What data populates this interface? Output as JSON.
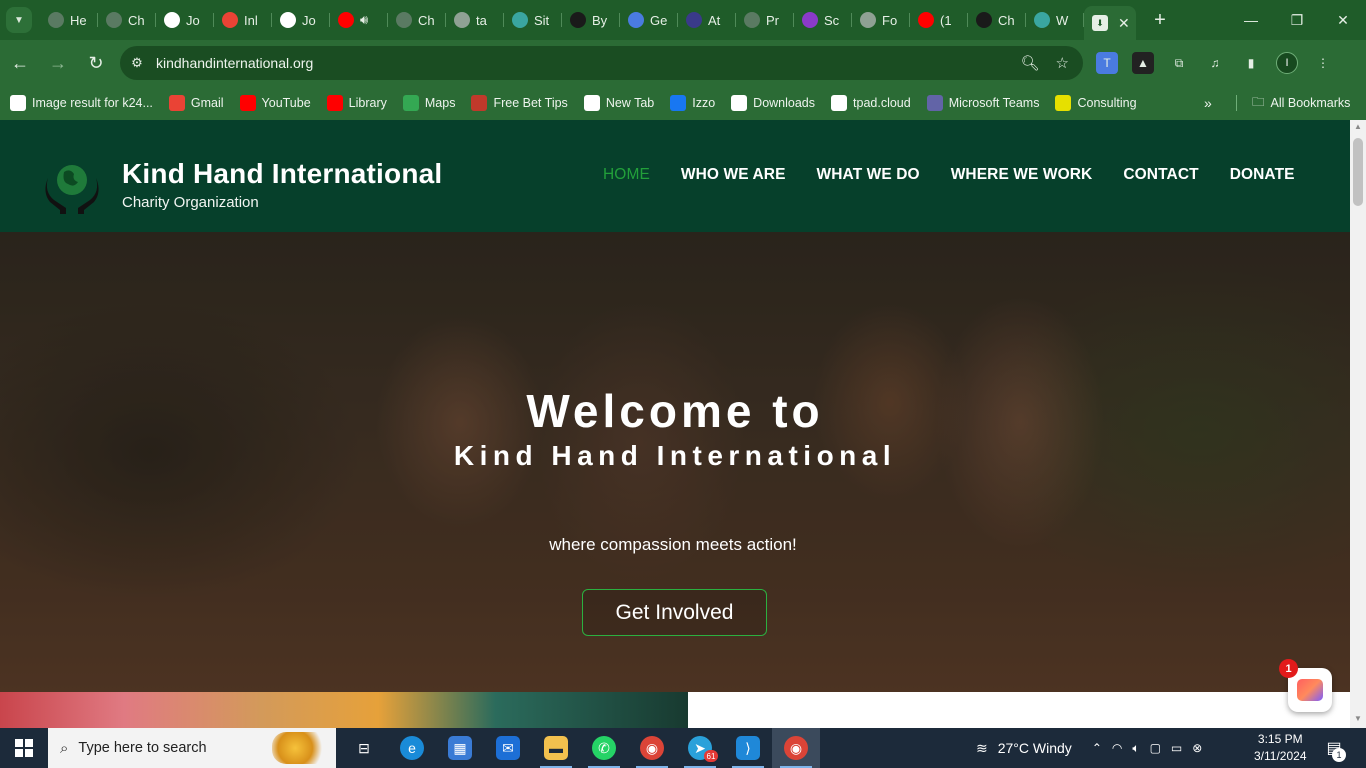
{
  "browser": {
    "tabs": [
      {
        "label": "He",
        "icon": "chatgpt-icon",
        "color": "#5a7a62"
      },
      {
        "label": "Ch",
        "icon": "chatgpt-icon",
        "color": "#5a7a62"
      },
      {
        "label": "Jo",
        "icon": "bookmark-icon",
        "color": "#ffffff"
      },
      {
        "label": "Inl",
        "icon": "gmail-icon",
        "color": "#ea4335"
      },
      {
        "label": "Jo",
        "icon": "bookmark-icon",
        "color": "#ffffff"
      },
      {
        "label": "",
        "icon": "youtube-icon",
        "color": "#ff0000"
      },
      {
        "label": "Ch",
        "icon": "chatgpt-icon",
        "color": "#5a7a62"
      },
      {
        "label": "ta",
        "icon": "globe-icon",
        "color": "#8fa194"
      },
      {
        "label": "Sit",
        "icon": "sitejet-icon",
        "color": "#3aa6a0"
      },
      {
        "label": "By",
        "icon": "openai-icon",
        "color": "#1a1a1a"
      },
      {
        "label": "Ge",
        "icon": "gemini-icon",
        "color": "#4a7be0"
      },
      {
        "label": "At",
        "icon": "atlas-icon",
        "color": "#3a3a8a"
      },
      {
        "label": "Pr",
        "icon": "chatgpt-icon",
        "color": "#5a7a62"
      },
      {
        "label": "Sc",
        "icon": "chart-icon",
        "color": "#8a3ac8"
      },
      {
        "label": "Fo",
        "icon": "globe-icon",
        "color": "#8fa194"
      },
      {
        "label": "(1",
        "icon": "youtube-icon",
        "color": "#ff0000"
      },
      {
        "label": "Ch",
        "icon": "openai-icon",
        "color": "#1a1a1a"
      },
      {
        "label": "W",
        "icon": "sitejet-icon",
        "color": "#3aa6a0"
      }
    ],
    "active_tab_icon": "download-favicon-icon",
    "url": "kindhandinternational.org",
    "bookmarks": [
      {
        "label": "Image result for k24...",
        "icon": "google-icon",
        "color": "#ffffff"
      },
      {
        "label": "Gmail",
        "icon": "gmail-icon",
        "color": "#ea4335"
      },
      {
        "label": "YouTube",
        "icon": "youtube-icon",
        "color": "#ff0000"
      },
      {
        "label": "Library",
        "icon": "youtube-icon",
        "color": "#ff0000"
      },
      {
        "label": "Maps",
        "icon": "maps-icon",
        "color": "#34a853"
      },
      {
        "label": "Free Bet Tips",
        "icon": "bet-icon",
        "color": "#c0392b"
      },
      {
        "label": "New Tab",
        "icon": "globe-icon",
        "color": "#ffffff"
      },
      {
        "label": "Izzo",
        "icon": "facebook-icon",
        "color": "#1877f2"
      },
      {
        "label": "Downloads",
        "icon": "download-icon",
        "color": "#ffffff"
      },
      {
        "label": "tpad.cloud",
        "icon": "globe-icon",
        "color": "#ffffff"
      },
      {
        "label": "Microsoft Teams",
        "icon": "teams-icon",
        "color": "#6264a7"
      },
      {
        "label": "Consulting",
        "icon": "consulting-icon",
        "color": "#e6e000"
      }
    ],
    "all_bookmarks_label": "All Bookmarks",
    "profile_initial": "I"
  },
  "site": {
    "title": "Kind Hand International",
    "subtitle": "Charity Organization",
    "nav": [
      "HOME",
      "WHO WE ARE",
      "WHAT WE DO",
      "WHERE WE WORK",
      "CONTACT",
      "DONATE"
    ],
    "active_nav_color": "#22a03a",
    "header_bg": "#06402b"
  },
  "hero": {
    "heading": "Welcome to",
    "subheading": "Kind Hand International",
    "tagline": "where compassion meets action!",
    "cta": "Get Involved"
  },
  "chat_widget": {
    "badge": "1"
  },
  "taskbar": {
    "search_placeholder": "Type here to search",
    "apps": [
      "task-view-icon",
      "edge-icon",
      "store-icon",
      "mail-icon",
      "file-explorer-icon",
      "whatsapp-icon",
      "chrome-icon",
      "telegram-icon",
      "vscode-icon",
      "chrome-icon"
    ],
    "telegram_badge": "61",
    "weather": "27°C  Windy",
    "time": "3:15 PM",
    "date": "3/11/2024",
    "notification_count": "1"
  }
}
